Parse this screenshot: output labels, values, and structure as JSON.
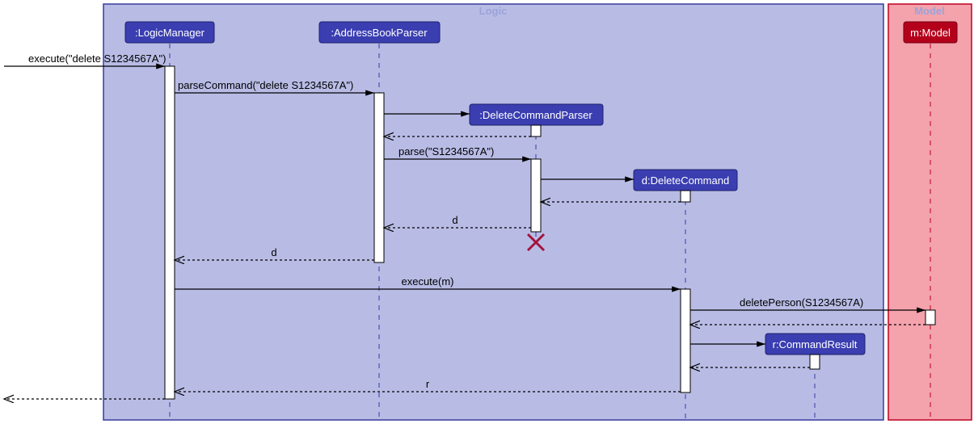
{
  "regions": {
    "logic": {
      "label": "Logic"
    },
    "model": {
      "label": "Model"
    }
  },
  "participants": {
    "logicManager": ":LogicManager",
    "addressBookParser": ":AddressBookParser",
    "deleteCommandParser": ":DeleteCommandParser",
    "deleteCommand": "d:DeleteCommand",
    "commandResult": "r:CommandResult",
    "model": "m:Model"
  },
  "messages": {
    "m1": "execute(\"delete S1234567A\")",
    "m2": "parseCommand(\"delete S1234567A\")",
    "m3": "parse(\"S1234567A\")",
    "m4": "d",
    "m5": "d",
    "m6": "execute(m)",
    "m7": "deletePerson(S1234567A)",
    "m8": "r"
  }
}
